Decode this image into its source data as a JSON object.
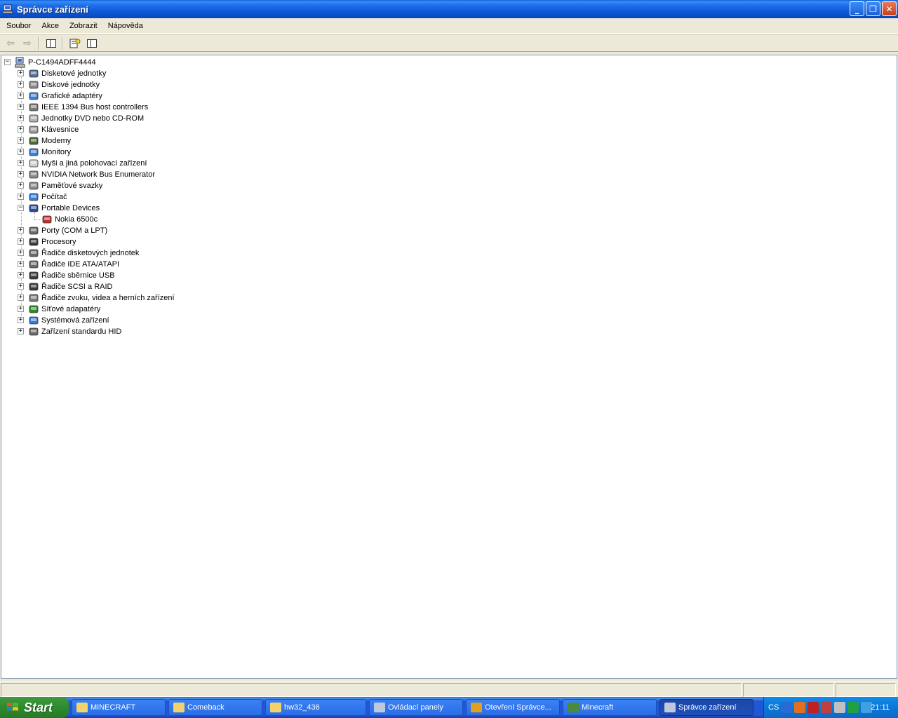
{
  "window": {
    "title": "Správce zařízení",
    "buttons": {
      "minimize": "_",
      "restore": "❐",
      "close": "✕"
    }
  },
  "menu": [
    "Soubor",
    "Akce",
    "Zobrazit",
    "Nápověda"
  ],
  "toolbar": {
    "back_icon": "arrow-left-icon",
    "forward_icon": "arrow-right-icon",
    "back_glyph": "⇦",
    "forward_glyph": "⇨"
  },
  "tree": {
    "root": "P-C1494ADFF4444",
    "categories": [
      {
        "label": "Disketové jednotky",
        "icon": "floppy-icon",
        "color": "#5a6e9a"
      },
      {
        "label": "Diskové jednotky",
        "icon": "disk-drive-icon",
        "color": "#8a8a8a"
      },
      {
        "label": "Grafické adaptéry",
        "icon": "display-adapter-icon",
        "color": "#3a7bd5"
      },
      {
        "label": "IEEE 1394 Bus host controllers",
        "icon": "ieee1394-icon",
        "color": "#7a7a7a"
      },
      {
        "label": "Jednotky DVD nebo CD-ROM",
        "icon": "cdrom-icon",
        "color": "#b0b0b0"
      },
      {
        "label": "Klávesnice",
        "icon": "keyboard-icon",
        "color": "#9a9a9a"
      },
      {
        "label": "Modemy",
        "icon": "modem-icon",
        "color": "#4a6a3a"
      },
      {
        "label": "Monitory",
        "icon": "monitor-icon",
        "color": "#3a7bd5"
      },
      {
        "label": "Myši a jiná polohovací zařízení",
        "icon": "mouse-icon",
        "color": "#d0d0d0"
      },
      {
        "label": "NVIDIA Network Bus Enumerator",
        "icon": "network-enumerator-icon",
        "color": "#8a8a8a"
      },
      {
        "label": "Paměťové svazky",
        "icon": "storage-volume-icon",
        "color": "#8a8a8a"
      },
      {
        "label": "Počítač",
        "icon": "computer-icon",
        "color": "#3a7bd5"
      },
      {
        "label": "Portable Devices",
        "icon": "portable-device-icon",
        "color": "#2a4a9a",
        "expanded": true,
        "children": [
          {
            "label": "Nokia 6500c",
            "icon": "phone-icon",
            "color": "#c03030"
          }
        ]
      },
      {
        "label": "Porty (COM a LPT)",
        "icon": "port-icon",
        "color": "#6a6a6a"
      },
      {
        "label": "Procesory",
        "icon": "processor-icon",
        "color": "#3a3a3a"
      },
      {
        "label": "Řadiče disketových jednotek",
        "icon": "floppy-controller-icon",
        "color": "#6a6a6a"
      },
      {
        "label": "Řadiče IDE ATA/ATAPI",
        "icon": "ide-controller-icon",
        "color": "#6a6a6a"
      },
      {
        "label": "Řadiče sběrnice USB",
        "icon": "usb-icon",
        "color": "#3a3a3a"
      },
      {
        "label": "Řadiče SCSI a RAID",
        "icon": "scsi-icon",
        "color": "#3a3a3a"
      },
      {
        "label": "Řadiče zvuku, videa a herních zařízení",
        "icon": "sound-icon",
        "color": "#7a7a7a"
      },
      {
        "label": "Síťové adapatéry",
        "icon": "network-adapter-icon",
        "color": "#2a8a2a"
      },
      {
        "label": "Systémová zařízení",
        "icon": "system-device-icon",
        "color": "#3a7bd5"
      },
      {
        "label": "Zařízení standardu HID",
        "icon": "hid-icon",
        "color": "#6a6a6a"
      }
    ]
  },
  "taskbar": {
    "start_label": "Start",
    "items": [
      {
        "label": "MINECRAFT",
        "icon": "folder-icon",
        "color": "#f2d36b"
      },
      {
        "label": "Comeback",
        "icon": "folder-icon",
        "color": "#f2d36b"
      },
      {
        "label": "hw32_436",
        "icon": "folder-icon",
        "color": "#f2d36b"
      },
      {
        "label": "Ovládací panely",
        "icon": "control-panel-icon",
        "color": "#c0c8e0"
      },
      {
        "label": "Otevření Správce...",
        "icon": "chrome-icon",
        "color": "#e0a020"
      },
      {
        "label": "Minecraft",
        "icon": "minecraft-icon",
        "color": "#4a8a3a"
      },
      {
        "label": "Správce zařízení",
        "icon": "device-manager-icon",
        "color": "#c0c8e0",
        "active": true
      }
    ],
    "tray": {
      "language": "CS",
      "time": "21:11",
      "icons": [
        {
          "name": "chevron-left-icon",
          "color": "#2a6ad6"
        },
        {
          "name": "app-icon",
          "color": "#e07020"
        },
        {
          "name": "acrobat-icon",
          "color": "#c02020"
        },
        {
          "name": "tool-icon",
          "color": "#c04040"
        },
        {
          "name": "volume-icon",
          "color": "#c0c0c0"
        },
        {
          "name": "security-icon",
          "color": "#20a040"
        },
        {
          "name": "network-icon",
          "color": "#40a0e0"
        }
      ]
    }
  }
}
